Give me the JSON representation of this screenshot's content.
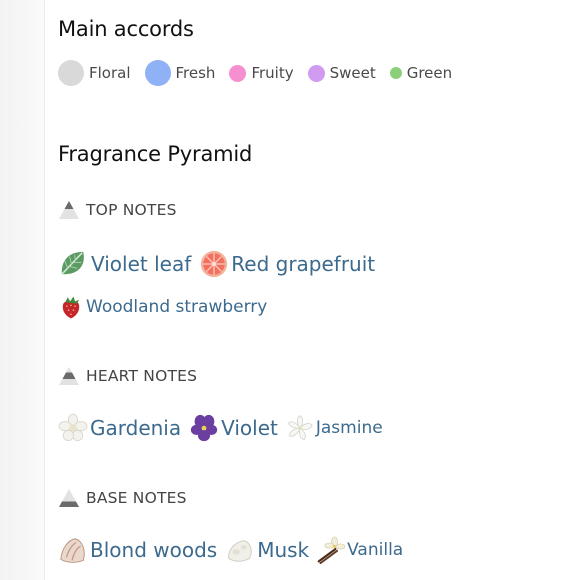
{
  "main_accords": {
    "title": "Main accords",
    "items": [
      {
        "label": "Floral",
        "color": "#d9d9d9"
      },
      {
        "label": "Fresh",
        "color": "#8fb1f5"
      },
      {
        "label": "Fruity",
        "color": "#f58fd0"
      },
      {
        "label": "Sweet",
        "color": "#d29bf2"
      },
      {
        "label": "Green",
        "color": "#8ccf7b"
      }
    ]
  },
  "pyramid": {
    "title": "Fragrance Pyramid",
    "top": {
      "label": "TOP NOTES",
      "notes": [
        {
          "name": "Violet leaf",
          "icon": "violet-leaf-icon"
        },
        {
          "name": "Red grapefruit",
          "icon": "grapefruit-icon"
        },
        {
          "name": "Woodland strawberry",
          "icon": "strawberry-icon"
        }
      ]
    },
    "heart": {
      "label": "HEART NOTES",
      "notes": [
        {
          "name": "Gardenia",
          "icon": "gardenia-icon"
        },
        {
          "name": "Violet",
          "icon": "violet-flower-icon"
        },
        {
          "name": "Jasmine",
          "icon": "jasmine-icon"
        }
      ]
    },
    "base": {
      "label": "BASE NOTES",
      "notes": [
        {
          "name": "Blond woods",
          "icon": "blond-woods-icon"
        },
        {
          "name": "Musk",
          "icon": "musk-icon"
        },
        {
          "name": "Vanilla",
          "icon": "vanilla-icon"
        }
      ]
    }
  }
}
